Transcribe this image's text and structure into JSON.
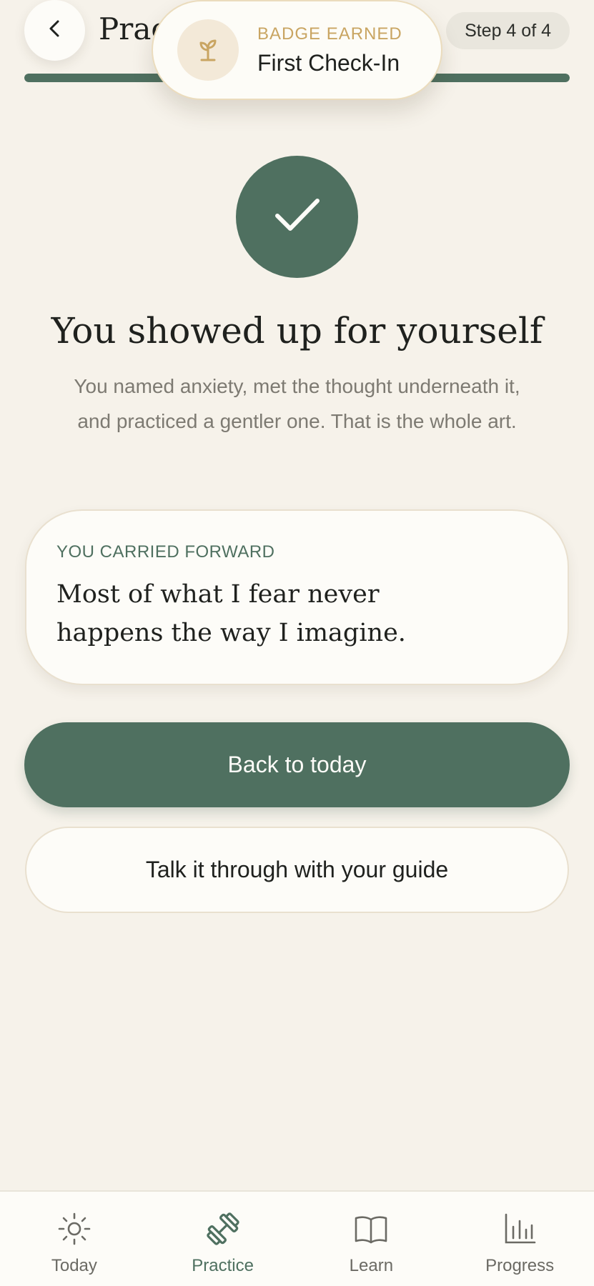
{
  "header": {
    "title": "Practice",
    "step_label": "Step 4 of 4",
    "progress": 1.0
  },
  "badge_toast": {
    "label": "BADGE EARNED",
    "name": "First Check-In",
    "icon": "sprout-icon"
  },
  "completion": {
    "icon": "check-icon",
    "headline": "You showed up for yourself",
    "body": "You named anxiety, met the thought underneath it, and practiced a gentler one. That is the whole art."
  },
  "carry_card": {
    "label": "YOU CARRIED FORWARD",
    "quote": "Most of what I fear never happens the way I imagine."
  },
  "actions": {
    "primary_label": "Back to today",
    "secondary_label": "Talk it through with your guide"
  },
  "bottom_nav": {
    "items": [
      {
        "label": "Today",
        "icon": "sun-icon",
        "active": false
      },
      {
        "label": "Practice",
        "icon": "dumbbell-icon",
        "active": true
      },
      {
        "label": "Learn",
        "icon": "book-icon",
        "active": false
      },
      {
        "label": "Progress",
        "icon": "bar-chart-icon",
        "active": false
      }
    ]
  },
  "colors": {
    "background": "#f6f2ea",
    "accent": "#4f7060",
    "badge_gold": "#c9a562",
    "muted_text": "#7d7a72"
  }
}
